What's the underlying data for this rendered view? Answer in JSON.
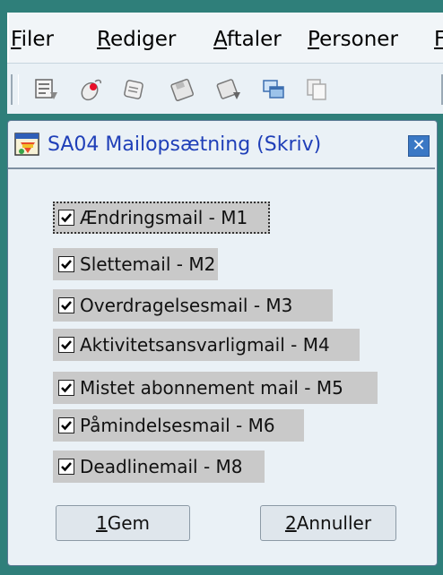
{
  "menubar": {
    "items": [
      {
        "accel": "F",
        "rest": "iler"
      },
      {
        "accel": "R",
        "rest": "ediger"
      },
      {
        "accel": "A",
        "rest": "ftaler"
      },
      {
        "accel": "P",
        "rest": "ersoner"
      },
      {
        "accel": "F",
        "rest": ""
      }
    ]
  },
  "toolbar": {
    "icons": [
      "list-icon",
      "mouse-icon",
      "note-icon",
      "disk-icon",
      "disk-down-icon",
      "windows-icon",
      "copy-icon"
    ]
  },
  "dialog": {
    "title": "SA04 Mailopsætning (Skriv)",
    "close_glyph": "✕",
    "checkboxes": [
      {
        "label": "Ændringsmail - M1",
        "checked": true
      },
      {
        "label": "Slettemail - M2",
        "checked": true
      },
      {
        "label": "Overdragelsesmail - M3",
        "checked": true
      },
      {
        "label": "Aktivitetsansvarligmail - M4",
        "checked": true
      },
      {
        "label": "Mistet abonnement mail - M5",
        "checked": true
      },
      {
        "label": "Påmindelsesmail - M6",
        "checked": true
      },
      {
        "label": "Deadlinemail - M8",
        "checked": true
      }
    ],
    "save_button": {
      "accel": "1",
      "rest": " Gem"
    },
    "cancel_button": {
      "accel": "2",
      "rest": " Annuller"
    }
  },
  "colors": {
    "desktop": "#2f7f7a",
    "title_text": "#1f3fb8",
    "row_highlight": "#c9c9c9"
  }
}
